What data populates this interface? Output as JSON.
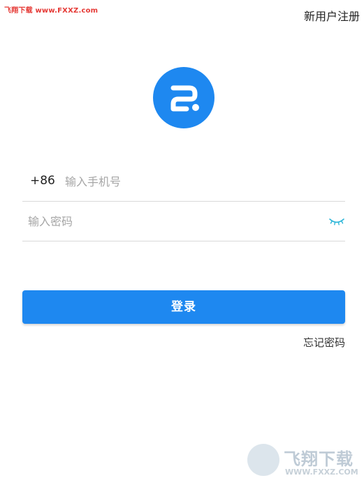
{
  "watermark": {
    "top_text": "飞翔下载 www.FXXZ.com",
    "brand": "飞翔下载",
    "url": "WWW.FXXZ.COM"
  },
  "header": {
    "register_link": "新用户注册"
  },
  "logo": {
    "color": "#1e88f0",
    "icon": "app-logo-icon"
  },
  "phone_field": {
    "country_code": "+86",
    "placeholder": "输入手机号",
    "value": ""
  },
  "password_field": {
    "placeholder": "输入密码",
    "value": "",
    "toggle_icon": "eye-closed-icon",
    "toggle_color": "#2bb5d8"
  },
  "login_button": {
    "label": "登录",
    "color": "#1e88f0"
  },
  "forgot_link": {
    "label": "忘记密码"
  }
}
